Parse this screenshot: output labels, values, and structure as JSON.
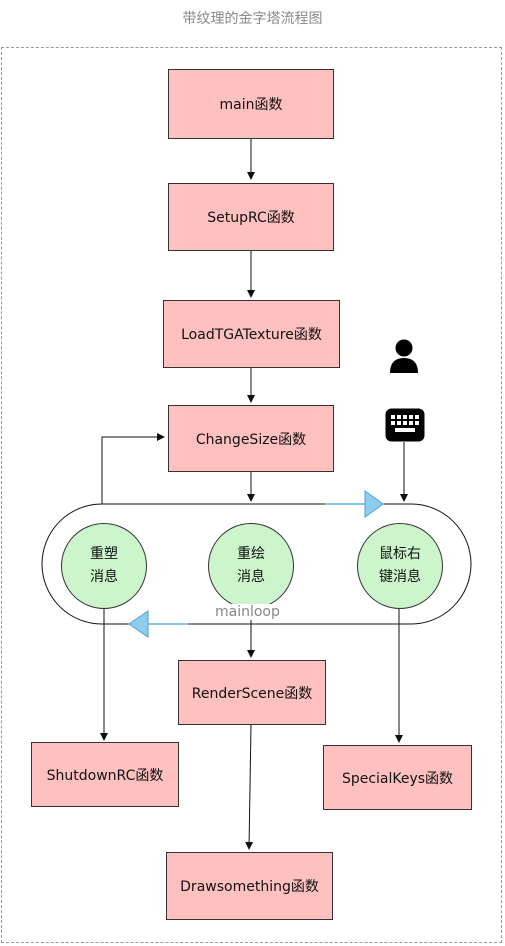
{
  "title": "带纹理的金字塔流程图",
  "nodes": {
    "main": "main函数",
    "setup": "SetupRC函数",
    "loadtga": "LoadTGATexture函数",
    "changesize": "ChangeSize函数",
    "render": "RenderScene函数",
    "shutdown": "ShutdownRC函数",
    "specialkeys": "SpecialKeys函数",
    "drawsomething": "Drawsomething函数"
  },
  "messages": {
    "reshape": "重塑\n消息",
    "redraw": "重绘\n消息",
    "mouse_right": "鼠标右\n键消息"
  },
  "loop_label": "mainloop",
  "icons": [
    "user-icon",
    "keyboard-icon"
  ],
  "colors": {
    "function_box": "#ffc0c0",
    "message_circle": "#ccf5cc",
    "loop_arrow": "#5fb0e0"
  }
}
